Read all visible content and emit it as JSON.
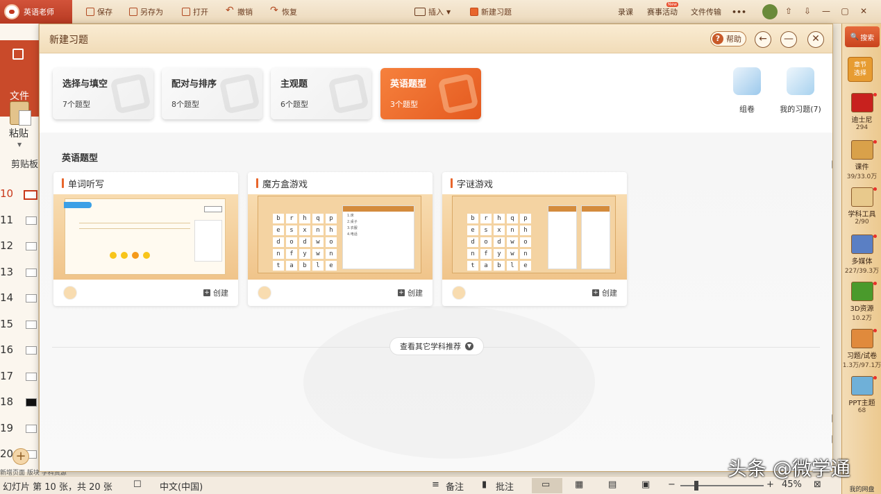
{
  "topbar": {
    "app_tab": "英语老师",
    "save": "保存",
    "save_as": "另存为",
    "open": "打开",
    "undo": "撤销",
    "redo": "恢复",
    "insert": "插入",
    "new_exercise": "新建习题",
    "record": "录课",
    "contest": "赛事活动",
    "contest_badge": "New",
    "file_transfer": "文件传输",
    "more": "•••"
  },
  "ribbon": {
    "file": "文件",
    "paste": "粘贴",
    "clipboard": "剪贴板",
    "slide_numbers": [
      "10",
      "11",
      "12",
      "13",
      "14",
      "15",
      "16",
      "17",
      "18",
      "19",
      "20"
    ],
    "add_slide": "+",
    "bottom_tabs": "新增页面   版块   学科资源"
  },
  "dialog": {
    "title": "新建习题",
    "help": "帮助",
    "categories": [
      {
        "name": "选择与填空",
        "count": "7个题型"
      },
      {
        "name": "配对与排序",
        "count": "8个题型"
      },
      {
        "name": "主观题",
        "count": "6个题型"
      },
      {
        "name": "英语题型",
        "count": "3个题型"
      }
    ],
    "side_tools": [
      {
        "label": "组卷"
      },
      {
        "label": "我的习题(7)"
      }
    ],
    "section_title": "英语题型",
    "templates": [
      {
        "name": "单词听写",
        "create": "创建"
      },
      {
        "name": "魔方盒游戏",
        "create": "创建"
      },
      {
        "name": "字谜游戏",
        "create": "创建"
      }
    ],
    "grid_letters": [
      [
        "b",
        "r",
        "h",
        "q",
        "p"
      ],
      [
        "e",
        "s",
        "x",
        "n",
        "h"
      ],
      [
        "d",
        "o",
        "d",
        "w",
        "o"
      ],
      [
        "n",
        "f",
        "y",
        "w",
        "n"
      ],
      [
        "t",
        "a",
        "b",
        "l",
        "e"
      ]
    ],
    "list_items": [
      "1.床",
      "2.桌子",
      "3.衣服",
      "4.电话"
    ],
    "more_button": "查看其它学科推荐"
  },
  "sidebar": {
    "search": "搜索",
    "chapter": "章节\n选择",
    "items": [
      {
        "label": "迪士尼",
        "count": "294"
      },
      {
        "label": "课件",
        "count": "39/33.0万"
      },
      {
        "label": "学科工具",
        "count": "2/90"
      },
      {
        "label": "多媒体",
        "count": "227/39.3万"
      },
      {
        "label": "3D资源",
        "count": "10.2万"
      },
      {
        "label": "习题/试卷",
        "count": "1.3万/97.1万"
      },
      {
        "label": "PPT主题",
        "count": "68"
      }
    ],
    "netdisk": "我的网盘"
  },
  "statusbar": {
    "slide_info": "幻灯片 第 10 张，共 20 张",
    "language": "中文(中国)",
    "notes": "备注",
    "comments": "批注",
    "zoom": "45%"
  },
  "watermark": "头条 @微学通"
}
